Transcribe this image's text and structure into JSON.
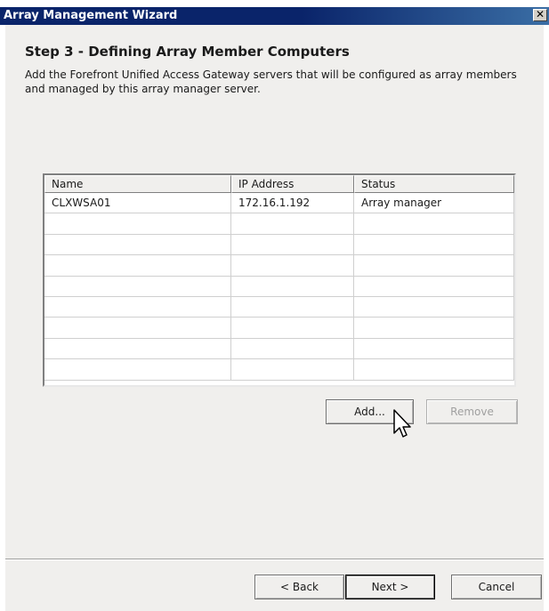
{
  "window": {
    "title": "Array Management Wizard",
    "close_glyph": "✕"
  },
  "step": {
    "title": "Step 3 - Defining Array Member Computers",
    "description": "Add the Forefront Unified Access Gateway servers that will be configured as array members and managed by this array manager server."
  },
  "table": {
    "columns": [
      "Name",
      "IP Address",
      "Status"
    ],
    "rows": [
      [
        "CLXWSA01",
        "172.16.1.192",
        "Array manager"
      ]
    ],
    "empty_rows": 8
  },
  "buttons": {
    "add": "Add...",
    "remove": "Remove",
    "back": "< Back",
    "next": "Next >",
    "cancel": "Cancel"
  },
  "icons": {
    "cursor": "mouse-pointer-icon",
    "close": "close-icon"
  }
}
